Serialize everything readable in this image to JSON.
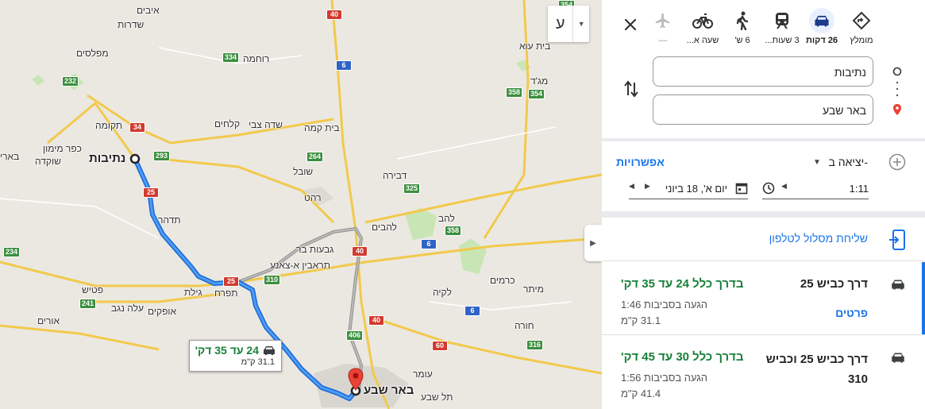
{
  "map": {
    "language_button": "ע",
    "places": [
      {
        "name": "איבים"
      },
      {
        "name": "שדרות"
      },
      {
        "name": "מפלסים"
      },
      {
        "name": "רוחמה"
      },
      {
        "name": "תקומה"
      },
      {
        "name": "כפר מימון"
      },
      {
        "name": "שוקדה"
      },
      {
        "name": "נתיבות"
      },
      {
        "name": "שדה צבי"
      },
      {
        "name": "קלחים"
      },
      {
        "name": "בית קמה"
      },
      {
        "name": "שובל"
      },
      {
        "name": "רהט"
      },
      {
        "name": "דבירה"
      },
      {
        "name": "להבים"
      },
      {
        "name": "להב"
      },
      {
        "name": "גבעות בר"
      },
      {
        "name": "תראבין א-צאנע"
      },
      {
        "name": "תדהר"
      },
      {
        "name": "גילת"
      },
      {
        "name": "תפרח"
      },
      {
        "name": "פטיש"
      },
      {
        "name": "עלה נגב"
      },
      {
        "name": "אופקים"
      },
      {
        "name": "אורים"
      },
      {
        "name": "לקיה"
      },
      {
        "name": "כרמים"
      },
      {
        "name": "מיתר"
      },
      {
        "name": "חורה"
      },
      {
        "name": "עומר"
      },
      {
        "name": "תל שבע"
      },
      {
        "name": "באר שבע"
      },
      {
        "name": "בית עוא"
      },
      {
        "name": "מג'ד"
      },
      {
        "name": "בארי"
      }
    ],
    "road_shields": [
      "40",
      "6",
      "334",
      "232",
      "34",
      "293",
      "264",
      "325",
      "25",
      "358",
      "358",
      "354",
      "354",
      "40",
      "310",
      "25",
      "241",
      "234",
      "406",
      "40",
      "6",
      "60",
      "316",
      "40"
    ],
    "callout": {
      "duration": "24 עד 35 דק'",
      "distance": "31.1 ק\"מ"
    },
    "colors": {
      "route": "#1a73e8",
      "alt_route": "#8f8f8f",
      "green_area": "#c8e6b5"
    }
  },
  "panel": {
    "modes": [
      {
        "icon": "diamond-route-icon",
        "label": "מומלץ"
      },
      {
        "icon": "car-icon",
        "label": "26 דקות",
        "selected": true
      },
      {
        "icon": "train-icon",
        "label": "3 שעות..."
      },
      {
        "icon": "walk-icon",
        "label": "6 ש'"
      },
      {
        "icon": "bike-icon",
        "label": "שעה א..."
      },
      {
        "icon": "plane-icon",
        "label": "—"
      }
    ],
    "origin": "נתיבות",
    "destination": "באר שבע",
    "depart_label": "יציאה ב-",
    "options_label": "אפשרויות",
    "time": "1:11",
    "date": "יום א', 18 ביוני",
    "send_to_phone": "שליחת מסלול לטלפון",
    "routes": [
      {
        "via": "דרך כביש 25",
        "duration": "בדרך כלל 24 עד 35 דק'",
        "arrival": "הגעה בסביבות 1:46",
        "distance": "31.1 ק\"מ",
        "details": "פרטים"
      },
      {
        "via": "דרך כביש 25 וכביש 310",
        "duration": "בדרך כלל 30 עד 45 דק'",
        "arrival": "הגעה בסביבות 1:56",
        "distance": "41.4 ק\"מ"
      }
    ]
  }
}
